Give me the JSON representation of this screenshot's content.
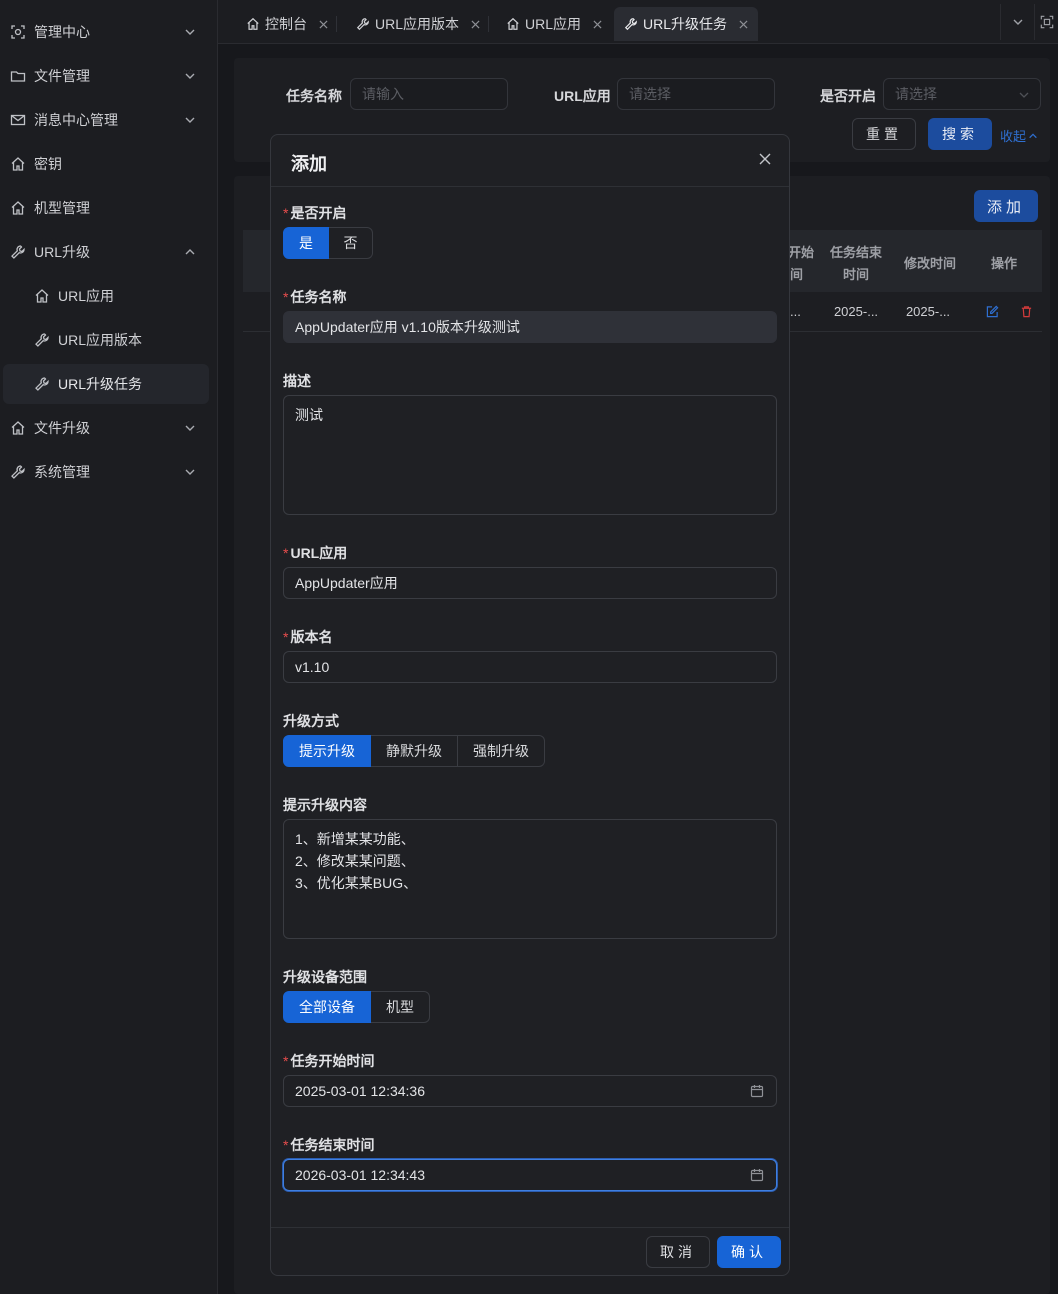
{
  "sidebar": {
    "items": [
      {
        "label": "管理中心",
        "icon": "control-center-icon"
      },
      {
        "label": "文件管理",
        "icon": "folder-icon"
      },
      {
        "label": "消息中心管理",
        "icon": "mail-icon"
      },
      {
        "label": "密钥",
        "icon": "home-icon"
      },
      {
        "label": "机型管理",
        "icon": "home-icon"
      },
      {
        "label": "URL升级",
        "icon": "wrench-icon"
      },
      {
        "label": "URL应用",
        "icon": "home-icon"
      },
      {
        "label": "URL应用版本",
        "icon": "wrench-icon"
      },
      {
        "label": "URL升级任务",
        "icon": "wrench-icon"
      },
      {
        "label": "文件升级",
        "icon": "home-icon"
      },
      {
        "label": "系统管理",
        "icon": "wrench-icon"
      }
    ]
  },
  "tabs": [
    {
      "label": "控制台",
      "icon": "home-icon"
    },
    {
      "label": "URL应用版本",
      "icon": "wrench-icon"
    },
    {
      "label": "URL应用",
      "icon": "home-icon"
    },
    {
      "label": "URL升级任务",
      "icon": "wrench-icon"
    }
  ],
  "search": {
    "task_name_label": "任务名称",
    "task_name_placeholder": "请输入",
    "url_app_label": "URL应用",
    "url_app_placeholder": "请选择",
    "enabled_label": "是否开启",
    "enabled_placeholder": "请选择",
    "reset_label": "重置",
    "search_label": "搜索",
    "collapse_label": "收起"
  },
  "table": {
    "add_label": "添加",
    "headers": [
      "开始时间",
      "任务结束时间",
      "修改时间",
      "操作"
    ],
    "header_start_partial_1": "开始",
    "header_start_partial_2": "间",
    "header_end_1": "任务结束",
    "header_end_2": "时间",
    "header_modified": "修改时间",
    "header_actions": "操作",
    "row": {
      "start": "...",
      "end": "2025-...",
      "modified": "2025-..."
    }
  },
  "modal": {
    "title": "添加",
    "enabled": {
      "label": "是否开启",
      "options": [
        "是",
        "否"
      ],
      "selected": "是"
    },
    "task_name": {
      "label": "任务名称",
      "value": "AppUpdater应用 v1.10版本升级测试"
    },
    "description": {
      "label": "描述",
      "value": "测试"
    },
    "url_app": {
      "label": "URL应用",
      "value": "AppUpdater应用"
    },
    "version": {
      "label": "版本名",
      "value": "v1.10"
    },
    "upgrade_mode": {
      "label": "升级方式",
      "options": [
        "提示升级",
        "静默升级",
        "强制升级"
      ],
      "selected": "提示升级"
    },
    "prompt_content": {
      "label": "提示升级内容",
      "value": "1、新增某某功能、\n2、修改某某问题、\n3、优化某某BUG、"
    },
    "device_scope": {
      "label": "升级设备范围",
      "options": [
        "全部设备",
        "机型"
      ],
      "selected": "全部设备"
    },
    "start_time": {
      "label": "任务开始时间",
      "value": "2025-03-01 12:34:36"
    },
    "end_time": {
      "label": "任务结束时间",
      "value": "2026-03-01 12:34:43"
    },
    "cancel_label": "取消",
    "confirm_label": "确认"
  },
  "colors": {
    "accent": "#1764d6",
    "danger": "#e84d4d",
    "background": "#17181c"
  }
}
